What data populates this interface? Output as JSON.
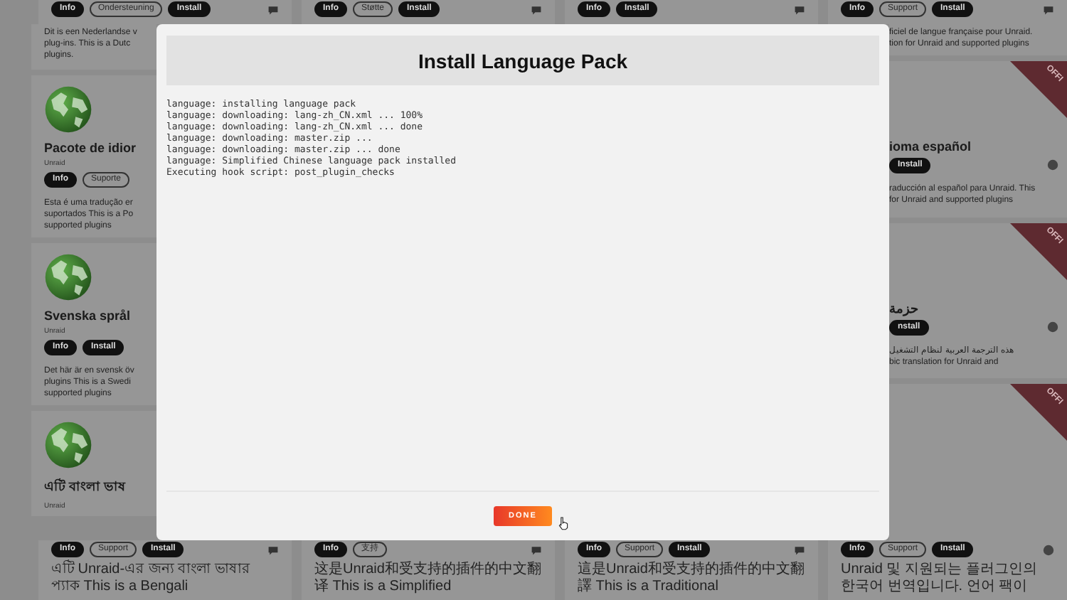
{
  "top_row": [
    {
      "buttons": [
        {
          "label": "Info",
          "kind": "solid"
        },
        {
          "label": "Ondersteuning",
          "kind": "outline"
        },
        {
          "label": "Install",
          "kind": "solid"
        }
      ],
      "kind": "chat"
    },
    {
      "buttons": [
        {
          "label": "Info",
          "kind": "solid"
        },
        {
          "label": "Støtte",
          "kind": "outline"
        },
        {
          "label": "Install",
          "kind": "solid"
        }
      ],
      "kind": "chat"
    },
    {
      "buttons": [
        {
          "label": "Info",
          "kind": "solid"
        },
        {
          "label": "Install",
          "kind": "solid"
        }
      ],
      "kind": "chat"
    },
    {
      "buttons": [
        {
          "label": "Info",
          "kind": "solid"
        },
        {
          "label": "Support",
          "kind": "outline"
        },
        {
          "label": "Install",
          "kind": "solid"
        }
      ],
      "kind": "chat"
    }
  ],
  "left_column": {
    "description": [
      "Dit is een Nederlandse v",
      "plug-ins. This is a Dutc",
      "plugins."
    ],
    "cards": [
      {
        "title": "Pacote de idior",
        "author": "Unraid",
        "buttons": [
          {
            "label": "Info",
            "kind": "solid"
          },
          {
            "label": "Suporte",
            "kind": "outline"
          }
        ],
        "description": [
          "Esta é uma tradução er",
          "suportados This is a Po",
          "supported plugins"
        ]
      },
      {
        "title": "Svenska språl",
        "author": "Unraid",
        "buttons": [
          {
            "label": "Info",
            "kind": "solid"
          },
          {
            "label": "Install",
            "kind": "solid"
          }
        ],
        "description": [
          "Det här är en svensk öv",
          "plugins This is a Swedi",
          "supported plugins"
        ]
      },
      {
        "title": "এটি বাংলা ভাষ",
        "author": "Unraid"
      }
    ]
  },
  "modal": {
    "title": "Install Language Pack",
    "log": [
      "language: installing language pack",
      "language: downloading: lang-zh_CN.xml ... 100%",
      "language: downloading: lang-zh_CN.xml ... done",
      "language: downloading: master.zip ...",
      "language: downloading: master.zip ... done",
      "language: Simplified Chinese language pack installed",
      "Executing hook script: post_plugin_checks"
    ],
    "done_button": "DONE"
  },
  "right_column": {
    "description": [
      "ficiel de langue française pour Unraid.",
      "tion for Unraid and supported plugins"
    ],
    "cards": [
      {
        "ribbon": "OFFI",
        "title": "ioma español",
        "buttons": [
          {
            "label": "Install",
            "kind": "solid"
          }
        ],
        "kind": "circle",
        "description": [
          "raducción al español para Unraid. This",
          "for Unraid and supported plugins"
        ]
      },
      {
        "ribbon": "OFFI",
        "title": "حزمة",
        "buttons": [
          {
            "label": "nstall",
            "kind": "solid"
          }
        ],
        "kind": "circle",
        "description": [
          "هذه الترجمة العربية لنظام التشغيل",
          "bic translation for Unraid and"
        ]
      },
      {
        "ribbon": "OFFI"
      }
    ]
  },
  "bottom_row": [
    {
      "buttons": [
        {
          "label": "Info",
          "kind": "solid"
        },
        {
          "label": "Support",
          "kind": "outline"
        },
        {
          "label": "Install",
          "kind": "solid"
        }
      ],
      "kind": "chat",
      "description": "এটি Unraid-এর জন্য বাংলা ভাষার প্যাক This is a Bengali"
    },
    {
      "buttons": [
        {
          "label": "Info",
          "kind": "solid"
        },
        {
          "label": "支持",
          "kind": "outline"
        }
      ],
      "kind": "chat",
      "description": "这是Unraid和受支持的插件的中文翻译 This is a Simplified"
    },
    {
      "buttons": [
        {
          "label": "Info",
          "kind": "solid"
        },
        {
          "label": "Support",
          "kind": "outline"
        },
        {
          "label": "Install",
          "kind": "solid"
        }
      ],
      "kind": "chat",
      "description": "這是Unraid和受支持的插件的中文翻譯 This is a Traditional"
    },
    {
      "buttons": [
        {
          "label": "Info",
          "kind": "solid"
        },
        {
          "label": "Support",
          "kind": "outline"
        },
        {
          "label": "Install",
          "kind": "solid"
        }
      ],
      "kind": "circle",
      "description": "Unraid 및 지원되는 플러그인의 한국어 번역입니다. 언어 팩이"
    }
  ]
}
